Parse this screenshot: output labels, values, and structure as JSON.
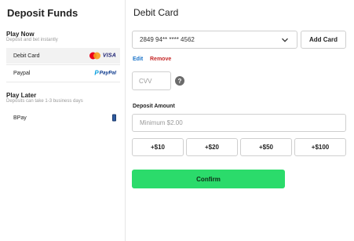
{
  "sidebar": {
    "title": "Deposit Funds",
    "play_now": {
      "title": "Play Now",
      "subtitle": "Deposit and bet instantly",
      "methods": [
        {
          "label": "Debit Card",
          "logos": [
            "mastercard-icon",
            "visa-icon"
          ],
          "visa_text": "VISA",
          "selected": true
        },
        {
          "label": "Paypal",
          "logos": [
            "paypal-icon"
          ],
          "paypal_text": "PayPal",
          "selected": false
        }
      ]
    },
    "play_later": {
      "title": "Play Later",
      "subtitle": "Deposits can take 1-3 business days",
      "methods": [
        {
          "label": "BPay",
          "logos": [
            "bpay-icon"
          ],
          "selected": false
        }
      ]
    }
  },
  "main": {
    "title": "Debit Card",
    "card_select": {
      "value": "2849 94** **** 4562"
    },
    "add_card_label": "Add Card",
    "edit_label": "Edit",
    "remove_label": "Remove",
    "cvv_placeholder": "CVV",
    "help_glyph": "?",
    "amount_label": "Deposit Amount",
    "amount_placeholder": "Minimum $2.00",
    "quick_amounts": [
      "+$10",
      "+$20",
      "+$50",
      "+$100"
    ],
    "confirm_label": "Confirm"
  },
  "colors": {
    "accent_green": "#2bdb6b",
    "edit_link": "#1a73c9",
    "remove_link": "#c62828",
    "selected_row_bg": "#f2f2f2"
  }
}
